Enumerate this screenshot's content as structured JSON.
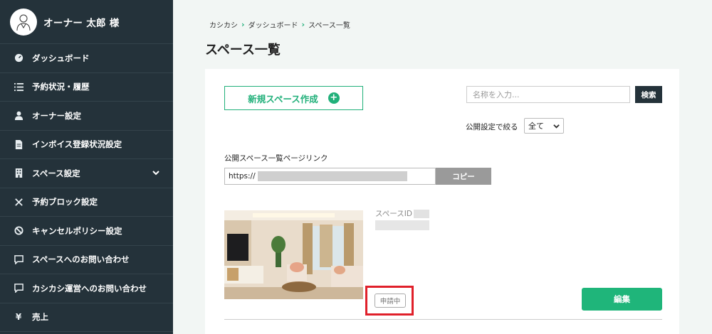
{
  "sidebar": {
    "user_name": "オーナー 太郎 様",
    "items": [
      {
        "label": "ダッシュボード",
        "icon": "dashboard-gauge-icon"
      },
      {
        "label": "予約状況・履歴",
        "icon": "list-icon"
      },
      {
        "label": "オーナー設定",
        "icon": "user-icon"
      },
      {
        "label": "インボイス登録状況設定",
        "icon": "document-icon"
      },
      {
        "label": "スペース設定",
        "icon": "building-icon"
      },
      {
        "label": "予約ブロック設定",
        "icon": "close-icon"
      },
      {
        "label": "キャンセルポリシー設定",
        "icon": "ban-icon"
      },
      {
        "label": "スペースへのお問い合わせ",
        "icon": "chat-icon"
      },
      {
        "label": "カシカシ運営へのお問い合わせ",
        "icon": "chat-icon"
      },
      {
        "label": "売上",
        "icon": "yen-icon"
      }
    ]
  },
  "breadcrumb": [
    "カシカシ",
    "ダッシュボード",
    "スペース一覧"
  ],
  "page_title": "スペース一覧",
  "new_space_button": "新規スペース作成",
  "search": {
    "placeholder": "名称を入力...",
    "button": "検索"
  },
  "filter": {
    "label": "公開設定で絞る",
    "value": "全て"
  },
  "public_link": {
    "label": "公開スペース一覧ページリンク",
    "prefix": "https://",
    "copy_button": "コピー"
  },
  "space": {
    "id_label": "スペースID",
    "status": "申請中",
    "edit_button": "編集"
  },
  "colors": {
    "sidebar_bg": "#24323a",
    "accent": "#21b07a",
    "highlight": "#e0202a"
  }
}
